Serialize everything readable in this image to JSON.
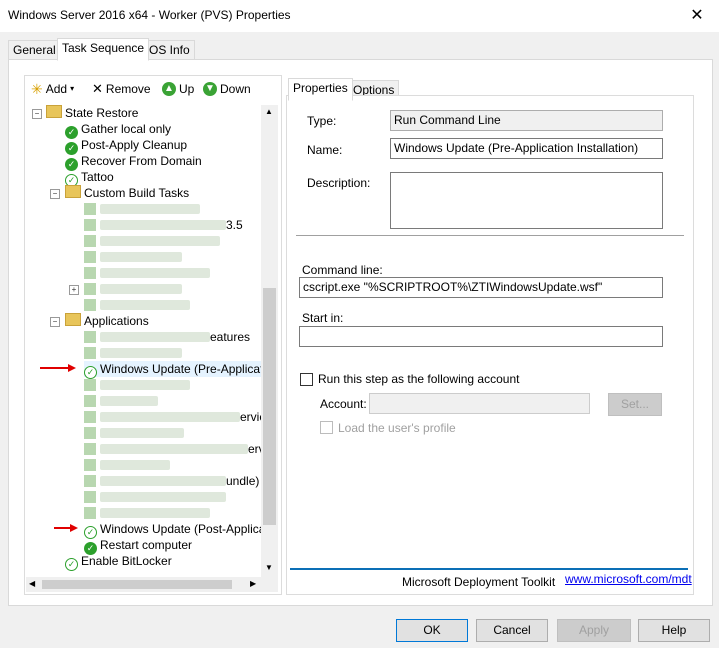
{
  "window": {
    "title": "Windows Server 2016 x64 - Worker (PVS) Properties",
    "close_glyph": "✕"
  },
  "tabs": [
    "General",
    "Task Sequence",
    "OS Info"
  ],
  "toolbar": {
    "add": "Add",
    "remove": "Remove",
    "up": "Up",
    "down": "Down"
  },
  "tree": {
    "state_restore": "State Restore",
    "gather": "Gather local only",
    "post_apply": "Post-Apply Cleanup",
    "recover": "Recover From Domain",
    "tattoo": "Tattoo",
    "custom_build": "Custom Build Tasks",
    "custom_partial": "3.5",
    "applications": "Applications",
    "features_partial": "eatures",
    "wu_pre": "Windows Update (Pre-Application",
    "services_partial": "ervice",
    "serve_partial": "erve",
    "bundle_partial": "undle)",
    "wu_post": "Windows Update (Post-Application",
    "restart": "Restart computer",
    "bitlocker": "Enable BitLocker"
  },
  "right_tabs": [
    "Properties",
    "Options"
  ],
  "properties": {
    "type_label": "Type:",
    "type_value": "Run Command Line",
    "name_label": "Name:",
    "name_value": "Windows Update (Pre-Application Installation)",
    "description_label": "Description:",
    "description_value": "",
    "command_label": "Command line:",
    "command_value": "cscript.exe \"%SCRIPTROOT%\\ZTIWindowsUpdate.wsf\"",
    "startin_label": "Start in:",
    "startin_value": "",
    "runas_label": "Run this step as the following account",
    "account_label": "Account:",
    "account_value": "",
    "set_button": "Set...",
    "load_profile_label": "Load the user's profile"
  },
  "footer": {
    "mdt": "Microsoft Deployment Toolkit",
    "link": "www.microsoft.com/mdt"
  },
  "buttons": {
    "ok": "OK",
    "cancel": "Cancel",
    "apply": "Apply",
    "help": "Help"
  },
  "colors": {
    "accent": "#0078d7",
    "check_green": "#2ca02c",
    "arrow_red": "#e00000",
    "link": "#0000ee"
  }
}
